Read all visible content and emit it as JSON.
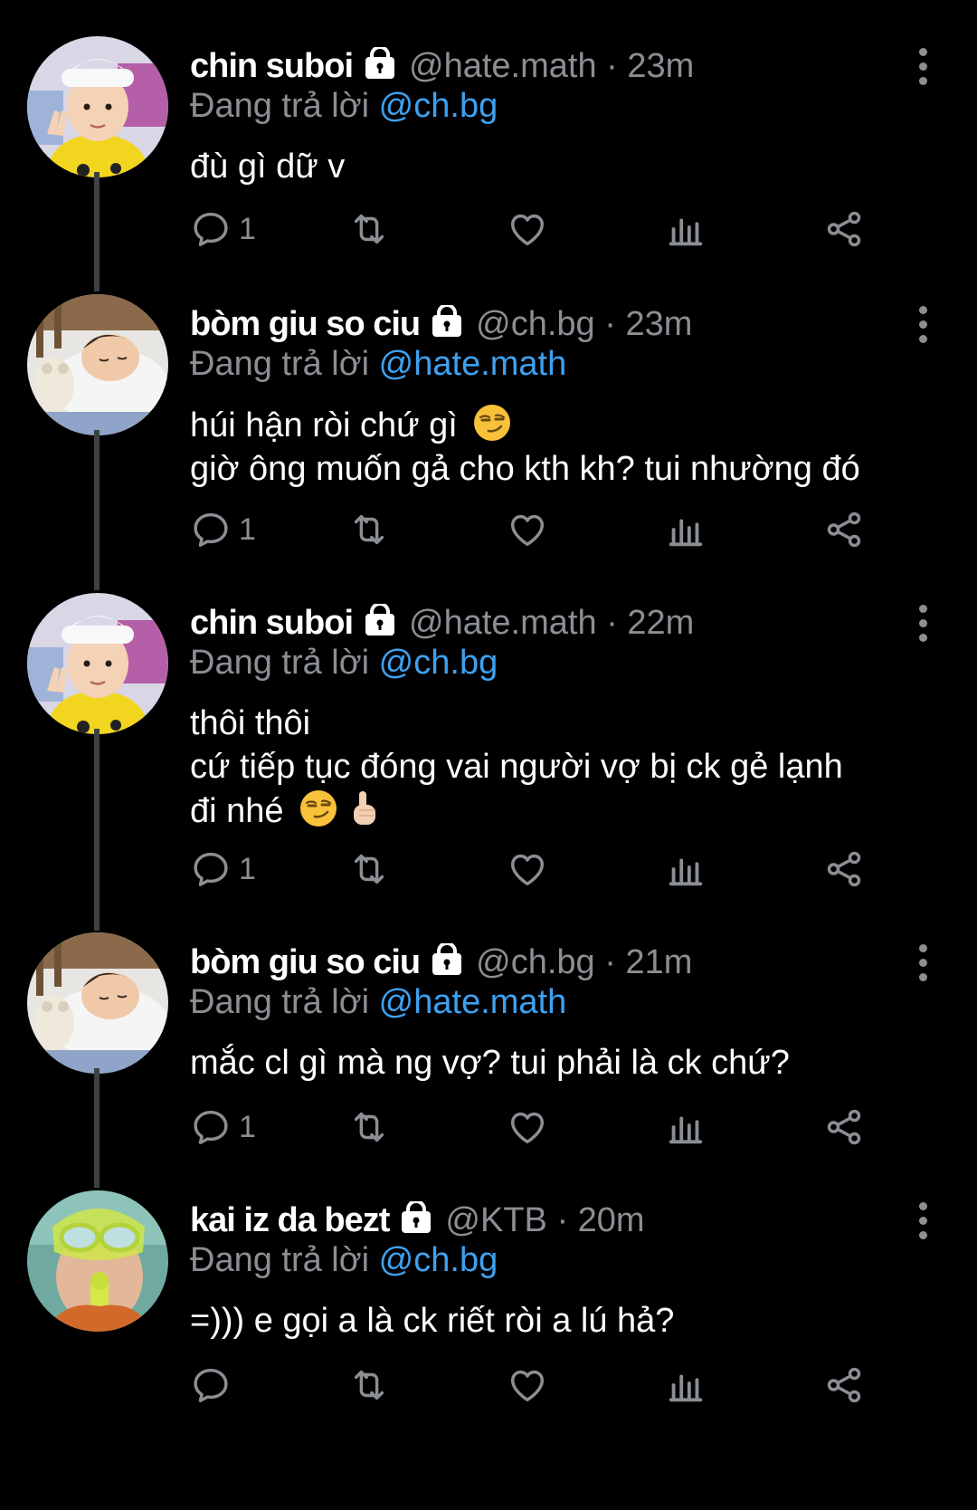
{
  "tweets": [
    {
      "name": "chin suboi",
      "handle": "@hate.math",
      "time": "· 23m",
      "replying_prefix": "Đang trả lời ",
      "replying_to": "@ch.bg",
      "lines": [
        "đù gì dữ v"
      ],
      "reply_count": "1",
      "avatar": "boy-yellow-shirt"
    },
    {
      "name": "bòm giu so ciu",
      "handle": "@ch.bg",
      "time": "· 23m",
      "replying_prefix": "Đang trả lời ",
      "replying_to": "@hate.math",
      "lines": [
        "húi hận ròi chứ gì",
        "giờ ông muốn gả cho kth kh? tui nhường đó"
      ],
      "reply_count": "1",
      "avatar": "sleeping-baby"
    },
    {
      "name": "chin suboi",
      "handle": "@hate.math",
      "time": "· 22m",
      "replying_prefix": "Đang trả lời ",
      "replying_to": "@ch.bg",
      "lines": [
        "thôi thôi",
        "cứ tiếp tục đóng vai người vợ bị ck gẻ lạnh",
        "đi nhé"
      ],
      "reply_count": "1",
      "avatar": "boy-yellow-shirt"
    },
    {
      "name": "bòm giu so ciu",
      "handle": "@ch.bg",
      "time": "· 21m",
      "replying_prefix": "Đang trả lời ",
      "replying_to": "@hate.math",
      "lines": [
        "mắc cl gì mà ng vợ? tui phải là ck chứ?"
      ],
      "reply_count": "1",
      "avatar": "sleeping-baby"
    },
    {
      "name": "kai iz da bezt",
      "handle": "@KTB",
      "time": "· 20m",
      "replying_prefix": "Đang trả lời ",
      "replying_to": "@ch.bg",
      "lines": [
        "=))) e gọi a là ck riết ròi a lú hả?"
      ],
      "reply_count": "",
      "avatar": "snorkel-child"
    }
  ],
  "colors": {
    "background": "#000000",
    "text": "#ffffff",
    "muted": "#8b8f94",
    "mention": "#3ea1f0",
    "thread_line": "#3e4144"
  },
  "icons": [
    "lock-icon",
    "more-icon",
    "reply-icon",
    "retweet-icon",
    "like-icon",
    "analytics-icon",
    "share-icon",
    "smirk-emoji",
    "pointing-up-emoji"
  ]
}
